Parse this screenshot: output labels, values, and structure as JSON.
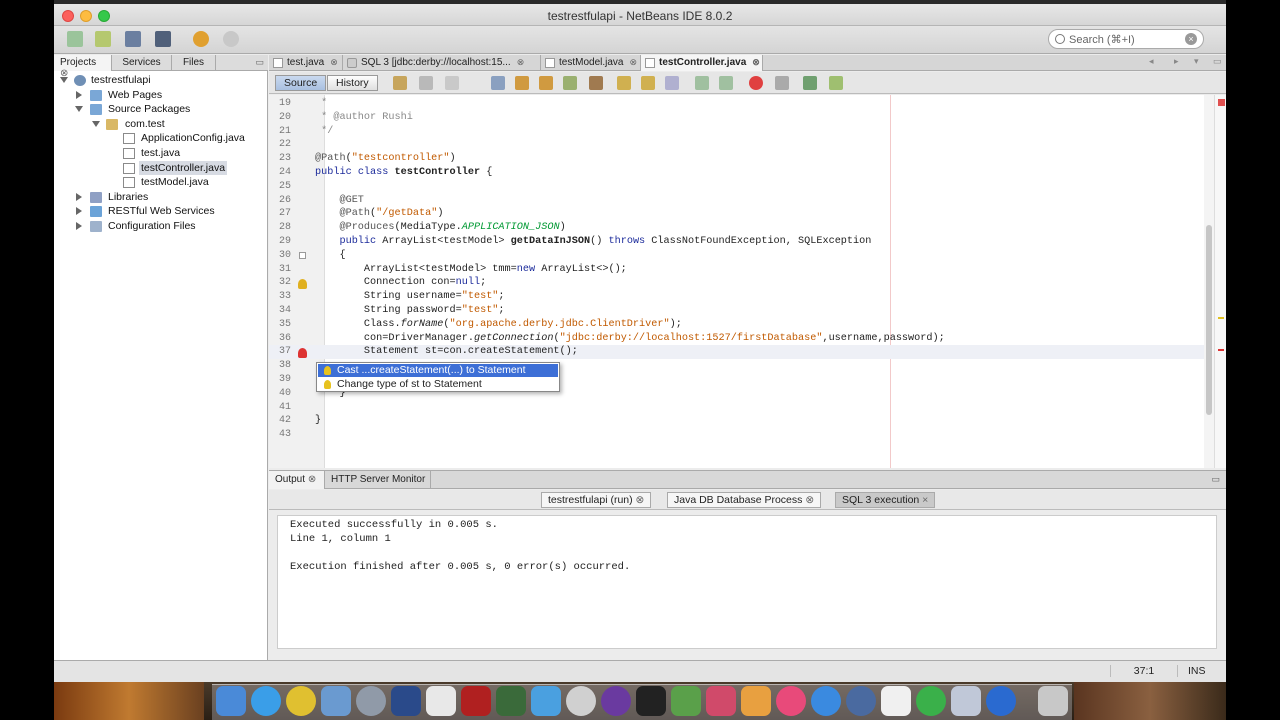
{
  "window": {
    "title": "testrestfulapi - NetBeans IDE 8.0.2"
  },
  "search": {
    "placeholder": "Search (⌘+I)"
  },
  "left_panel": {
    "tabs": [
      "Projects",
      "Services",
      "Files"
    ],
    "tree": [
      {
        "label": "testrestfulapi",
        "icon": "project-globe-icon",
        "expanded": true,
        "depth": 0
      },
      {
        "label": "Web Pages",
        "icon": "folder-icon",
        "expanded": false,
        "depth": 1
      },
      {
        "label": "Source Packages",
        "icon": "folder-icon",
        "expanded": true,
        "depth": 1
      },
      {
        "label": "com.test",
        "icon": "package-icon",
        "expanded": true,
        "depth": 2
      },
      {
        "label": "ApplicationConfig.java",
        "icon": "java-file-icon",
        "depth": 3
      },
      {
        "label": "test.java",
        "icon": "java-file-icon",
        "depth": 3
      },
      {
        "label": "testController.java",
        "icon": "java-file-icon",
        "depth": 3,
        "selected": true
      },
      {
        "label": "testModel.java",
        "icon": "java-file-icon",
        "depth": 3
      },
      {
        "label": "Libraries",
        "icon": "library-icon",
        "expanded": false,
        "depth": 1
      },
      {
        "label": "RESTful Web Services",
        "icon": "rest-icon",
        "expanded": false,
        "depth": 1
      },
      {
        "label": "Configuration Files",
        "icon": "config-icon",
        "expanded": false,
        "depth": 1
      }
    ]
  },
  "editor_tabs": [
    {
      "label": "test.java",
      "active": false
    },
    {
      "label": "SQL 3 [jdbc:derby://localhost:15...",
      "active": false
    },
    {
      "label": "testModel.java",
      "active": false
    },
    {
      "label": "testController.java",
      "active": true
    }
  ],
  "editor_toolbar": {
    "source_label": "Source",
    "history_label": "History"
  },
  "code_lines": [
    {
      "n": "19",
      "text": " *"
    },
    {
      "n": "20",
      "text": " * @author Rushi"
    },
    {
      "n": "21",
      "text": " */"
    },
    {
      "n": "22",
      "text": ""
    },
    {
      "n": "23",
      "text": "@Path(\"testcontroller\")"
    },
    {
      "n": "24",
      "text": "public class testController {"
    },
    {
      "n": "25",
      "text": ""
    },
    {
      "n": "26",
      "text": "    @GET"
    },
    {
      "n": "27",
      "text": "    @Path(\"/getData\")"
    },
    {
      "n": "28",
      "text": "    @Produces(MediaType.APPLICATION_JSON)"
    },
    {
      "n": "29",
      "text": "    public ArrayList<testModel> getDataInJSON() throws ClassNotFoundException, SQLException"
    },
    {
      "n": "30",
      "text": "    {"
    },
    {
      "n": "31",
      "text": "        ArrayList<testModel> tmm=new ArrayList<>();"
    },
    {
      "n": "32",
      "text": "        Connection con=null;"
    },
    {
      "n": "33",
      "text": "        String username=\"test\";"
    },
    {
      "n": "34",
      "text": "        String password=\"test\";"
    },
    {
      "n": "35",
      "text": "        Class.forName(\"org.apache.derby.jdbc.ClientDriver\");"
    },
    {
      "n": "36",
      "text": "        con=DriverManager.getConnection(\"jdbc:derby://localhost:1527/firstDatabase\",username,password);"
    },
    {
      "n": "37",
      "text": "        Statement st=con.createStatement();"
    },
    {
      "n": "38",
      "text": ""
    },
    {
      "n": "39",
      "text": ""
    },
    {
      "n": "40",
      "text": "    }"
    },
    {
      "n": "41",
      "text": ""
    },
    {
      "n": "42",
      "text": "}"
    },
    {
      "n": "43",
      "text": ""
    }
  ],
  "hint_popup": {
    "items": [
      {
        "label": "Cast ...createStatement(...) to Statement",
        "selected": true
      },
      {
        "label": "Change type of st to Statement",
        "selected": false
      }
    ]
  },
  "output": {
    "tabs": [
      "Output",
      "HTTP Server Monitor"
    ],
    "sub_tabs": [
      {
        "label": "testrestfulapi (run)",
        "active": false
      },
      {
        "label": "Java DB Database Process",
        "active": false
      },
      {
        "label": "SQL 3 execution",
        "active": true
      }
    ],
    "lines": [
      "Executed successfully in 0.005 s.",
      "Line 1, column 1",
      "",
      "Execution finished after 0.005 s, 0 error(s) occurred."
    ]
  },
  "status": {
    "position": "37:1",
    "mode": "INS"
  },
  "colors": {
    "selection": "#3d6fd6",
    "keyword": "#1c2b9b",
    "string": "#c15a00"
  }
}
